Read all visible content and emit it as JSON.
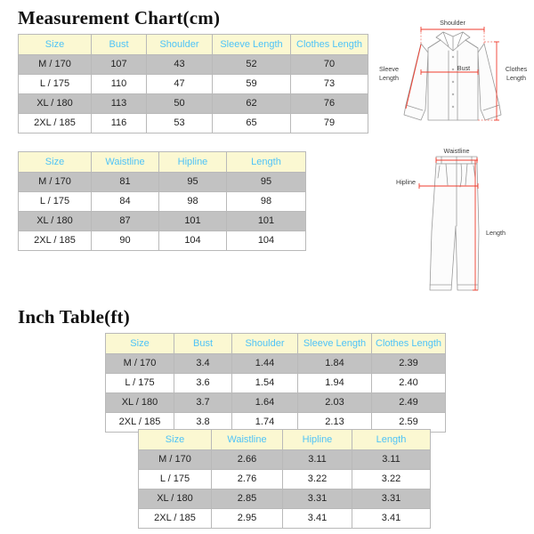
{
  "page": {
    "background_color": "#ffffff",
    "header_color": "#fbf8d2",
    "header_text_color": "#4fc3f7",
    "shade_row_color": "#c2c2c2",
    "border_color": "#b9b9b9",
    "measure_line_color": "#ef3b2c",
    "garment_line_color": "#9a9a9a"
  },
  "sections": {
    "cm": {
      "title": "Measurement Chart(cm)"
    },
    "inch": {
      "title": "Inch Table(ft)"
    }
  },
  "tables": {
    "cm_top": {
      "name": "Measurement Chart (cm) - Top",
      "headers": [
        "Size",
        "Bust",
        "Shoulder",
        "Sleeve Length",
        "Clothes Length"
      ],
      "rows": [
        [
          "M / 170",
          "107",
          "43",
          "52",
          "70"
        ],
        [
          "L / 175",
          "110",
          "47",
          "59",
          "73"
        ],
        [
          "XL / 180",
          "113",
          "50",
          "62",
          "76"
        ],
        [
          "2XL / 185",
          "116",
          "53",
          "65",
          "79"
        ]
      ]
    },
    "cm_bottom": {
      "name": "Measurement Chart (cm) - Bottom",
      "headers": [
        "Size",
        "Waistline",
        "Hipline",
        "Length"
      ],
      "rows": [
        [
          "M / 170",
          "81",
          "95",
          "95"
        ],
        [
          "L / 175",
          "84",
          "98",
          "98"
        ],
        [
          "XL / 180",
          "87",
          "101",
          "101"
        ],
        [
          "2XL / 185",
          "90",
          "104",
          "104"
        ]
      ]
    },
    "inch_top": {
      "name": "Inch Table (ft) - Top",
      "headers": [
        "Size",
        "Bust",
        "Shoulder",
        "Sleeve Length",
        "Clothes Length"
      ],
      "rows": [
        [
          "M / 170",
          "3.4",
          "1.44",
          "1.84",
          "2.39"
        ],
        [
          "L / 175",
          "3.6",
          "1.54",
          "1.94",
          "2.40"
        ],
        [
          "XL / 180",
          "3.7",
          "1.64",
          "2.03",
          "2.49"
        ],
        [
          "2XL / 185",
          "3.8",
          "1.74",
          "2.13",
          "2.59"
        ]
      ]
    },
    "inch_bottom": {
      "name": "Inch Table (ft) - Bottom",
      "headers": [
        "Size",
        "Waistline",
        "Hipline",
        "Length"
      ],
      "rows": [
        [
          "M / 170",
          "2.66",
          "3.11",
          "3.11"
        ],
        [
          "L / 175",
          "2.76",
          "3.22",
          "3.22"
        ],
        [
          "XL / 180",
          "2.85",
          "3.31",
          "3.31"
        ],
        [
          "2XL / 185",
          "2.95",
          "3.41",
          "3.41"
        ]
      ]
    }
  },
  "diagrams": {
    "shirt": {
      "name": "shirt-measurement-diagram",
      "labels": {
        "shoulder": "Shoulder",
        "bust": "Bust",
        "sleeve_length_1": "Sleeve",
        "sleeve_length_2": "Length",
        "clothes_length_1": "Clothes",
        "clothes_length_2": "Length"
      }
    },
    "pants": {
      "name": "pants-measurement-diagram",
      "labels": {
        "waistline": "Waistline",
        "hipline": "Hipline",
        "length": "Length"
      }
    }
  }
}
